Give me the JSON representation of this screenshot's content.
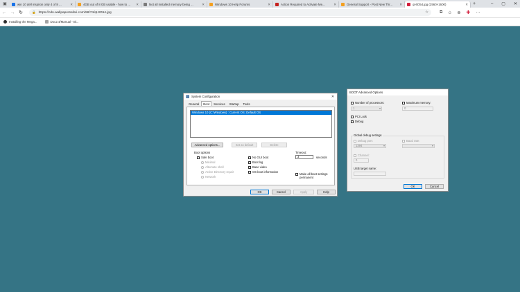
{
  "browser": {
    "tabs": [
      {
        "title": "win 10 dell inspiron only 4 of 8 ...",
        "fav_color": "#1a73e8",
        "active": false
      },
      {
        "title": "4GB out of 8 GB usable - how to ...",
        "fav_color": "#f4a020",
        "active": false
      },
      {
        "title": "Not all installed memory being ...",
        "fav_color": "#7a7a7a",
        "active": false
      },
      {
        "title": "Windows 10 Help Forums",
        "fav_color": "#f4a020",
        "active": false
      },
      {
        "title": "Action Required to Activate Me...",
        "fav_color": "#c5221f",
        "active": false
      },
      {
        "title": "General Support - Post New Thr...",
        "fav_color": "#f4a020",
        "active": false
      },
      {
        "title": "qHtO54.jpg (2560×1600)",
        "fav_color": "#d21e3c",
        "active": true
      }
    ],
    "url": "https://cdn.wallpapersafari.com/58/74/qHtO54.jpg",
    "bookmarks": [
      {
        "label": "Installing the Mega..."
      },
      {
        "label": "Doc2.4/Manual - Bl..."
      }
    ],
    "background_color": "#357485"
  },
  "syscfg": {
    "title": "System Configuration",
    "tabs": [
      "General",
      "Boot",
      "Services",
      "Startup",
      "Tools"
    ],
    "active_tab": "Boot",
    "os_entry": "Windows 10 (C:\\Windows) : Current OS; Default OS",
    "advanced_btn": "Advanced options...",
    "set_default_btn": "Set as default",
    "delete_btn": "Delete",
    "boot_options_label": "Boot options",
    "safe_boot": "Safe boot",
    "minimal": "Minimal",
    "alt_shell": "Alternate shell",
    "ad_repair": "Active Directory repair",
    "network": "Network",
    "no_gui": "No GUI boot",
    "boot_log": "Boot log",
    "base_video": "Base video",
    "os_boot_info": "OS boot information",
    "timeout_label": "Timeout:",
    "timeout_value": "3",
    "seconds": "seconds",
    "permanent": "Make all boot settings permanent",
    "ok": "OK",
    "cancel": "Cancel",
    "apply": "Apply",
    "help": "Help"
  },
  "bootadv": {
    "title": "BOOT Advanced Options",
    "num_proc": "Number of processors:",
    "num_proc_value": "1",
    "max_mem": "Maximum memory:",
    "max_mem_value": "0",
    "pci_lock": "PCI Lock",
    "debug": "Debug",
    "global_debug": "Global debug settings",
    "debug_port": "Debug port:",
    "debug_port_value": "1394",
    "baud_rate": "Baud rate:",
    "channel": "Channel:",
    "channel_value": "0",
    "usb_target": "USB target name:",
    "ok": "OK",
    "cancel": "Cancel"
  }
}
